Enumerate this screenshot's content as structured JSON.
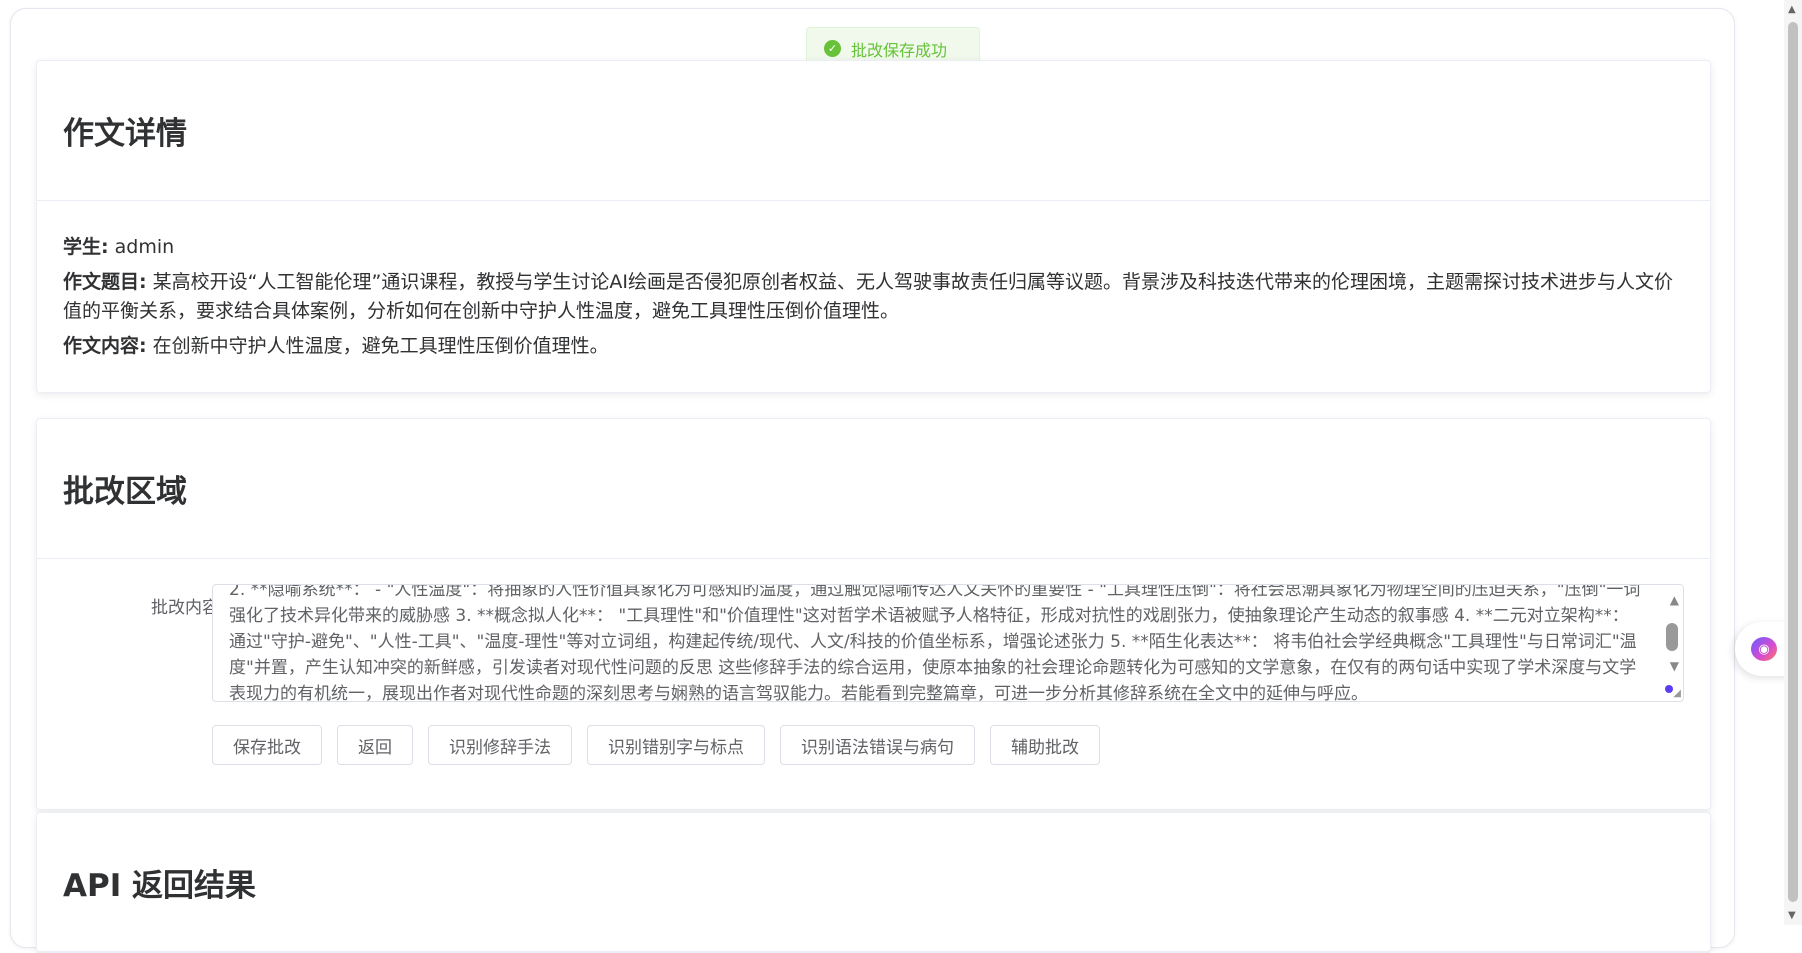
{
  "toast": {
    "message": "批改保存成功",
    "icon": "check-circle-icon",
    "color": "#67c23a"
  },
  "essay_detail": {
    "title": "作文详情",
    "student_label": "学生:",
    "student_value": "admin",
    "topic_label": "作文题目:",
    "topic_value": "某高校开设“人工智能伦理”通识课程，教授与学生讨论AI绘画是否侵犯原创者权益、无人驾驶事故责任归属等议题。背景涉及科技迭代带来的伦理困境，主题需探讨技术进步与人文价值的平衡关系，要求结合具体案例，分析如何在创新中守护人性温度，避免工具理性压倒价值理性。",
    "content_label": "作文内容:",
    "content_value": "在创新中守护人性温度，避免工具理性压倒价值理性。"
  },
  "correction_area": {
    "title": "批改区域",
    "field_label": "批改内容",
    "textarea_value": "2. **隐喻系统**： - \"人性温度\"：将抽象的人性价值具象化为可感知的温度，通过触觉隐喻传达人文关怀的重要性 - \"工具理性压倒\"：将社会思潮具象化为物理空间的压迫关系，\"压倒\"一词强化了技术异化带来的威胁感 3. **概念拟人化**： \"工具理性\"和\"价值理性\"这对哲学术语被赋予人格特征，形成对抗性的戏剧张力，使抽象理论产生动态的叙事感 4. **二元对立架构**： 通过\"守护-避免\"、\"人性-工具\"、\"温度-理性\"等对立词组，构建起传统/现代、人文/科技的价值坐标系，增强论述张力 5. **陌生化表达**： 将韦伯社会学经典概念\"工具理性\"与日常词汇\"温度\"并置，产生认知冲突的新鲜感，引发读者对现代性问题的反思 这些修辞手法的综合运用，使原本抽象的社会理论命题转化为可感知的文学意象，在仅有的两句话中实现了学术深度与文学表现力的有机统一，展现出作者对现代性命题的深刻思考与娴熟的语言驾驭能力。若能看到完整篇章，可进一步分析其修辞系统在全文中的延伸与呼应。",
    "buttons": {
      "save": "保存批改",
      "back": "返回",
      "rhetoric": "识别修辞手法",
      "typos": "识别错别字与标点",
      "grammar": "识别语法错误与病句",
      "assist": "辅助批改"
    }
  },
  "api_result": {
    "title": "API 返回结果"
  },
  "side_widget": {
    "icon": "brain-icon"
  }
}
